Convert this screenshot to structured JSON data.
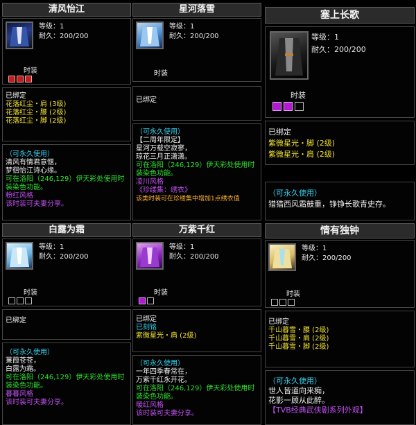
{
  "cards": {
    "c1": {
      "name": "清风怡江",
      "level": "等级：1",
      "durability": "耐久：200/200",
      "type": "时装",
      "bound": "已绑定",
      "sets": [
        "花落红尘・肩 (3级)",
        "花落红尘・腰 (2级)",
        "花落红尘・脚 (2级)"
      ],
      "usage": "（可永久使用）",
      "lines": [
        "清风有情君意惬，",
        "梦徊怡江诗心缘。",
        "可在洛阳（246,129）伊天彩处使用时",
        "装染色功能。",
        "粉红风格",
        "该时装可夫妻分享。"
      ]
    },
    "c2": {
      "name": "星河落雪",
      "level": "等级：1",
      "durability": "耐久：200/200",
      "type": "时装",
      "bound": "已绑定",
      "usage": "（可永久使用）",
      "lines": [
        "【二周年限定】",
        "星河万载空寂寥，",
        "琼花三月正潇潇。",
        "可在洛阳（246,129）伊天彩处使用时",
        "装染色功能。",
        "凌川风格",
        "《珍缕集：绣衣》",
        "该类时装可在珍缕集中增加1点绣衣值"
      ]
    },
    "c3": {
      "name": "塞上长歌",
      "level": "等级：1",
      "durability": "耐久：200/200",
      "type": "时装",
      "bound": "已绑定",
      "sets": [
        "紫微星光・脚 (2级)",
        "紫微星光・肩 (2级)"
      ],
      "usage": "（可永久使用）",
      "lines": [
        "猎猎西风霜鼓重，铮铮长歌青史存。"
      ]
    },
    "c4": {
      "name": "白露为霜",
      "level": "等级：1",
      "durability": "耐久：200/200",
      "type": "时装",
      "bound": "已绑定",
      "usage": "（可永久使用）",
      "lines": [
        "蒹葭苍苍，",
        "白露为霜。",
        "可在洛阳（246,129）伊天彩处使用时",
        "装染色功能。",
        "暮暮风格",
        "该时装可夫妻分享。"
      ]
    },
    "c5": {
      "name": "万紫千红",
      "level": "等级：1",
      "durability": "耐久：200/200",
      "type": "时装",
      "bound": "已绑定",
      "sets": [
        "已刻铭",
        "紫微星光・肩 (2级)"
      ],
      "usage": "（可永久使用）",
      "lines": [
        "一年四季春常在，",
        "万紫千红永开花。",
        "可在洛阳（246,129）伊天彩处使用时",
        "装染色功能。",
        "暖红风格",
        "该时装可夫妻分享。"
      ]
    },
    "c6": {
      "name": "情有独钟",
      "level": "等级：1",
      "durability": "耐久：200/200",
      "type": "时装",
      "bound": "已绑定",
      "sets": [
        "千山暮雪・腰 (2级)",
        "千山暮雪・肩 (2级)",
        "千山暮雪・脚 (2级)"
      ],
      "usage": "（可永久使用）",
      "lines": [
        "世人皆道向来痴，",
        "花影一顾从此醉。",
        "【TVB经典武侠剧系列外观】"
      ]
    }
  },
  "colors": {
    "gold": "#f0e030",
    "cyan": "#35d1f0",
    "green": "#2fe02f",
    "purple": "#c050f0",
    "orange": "#ffb030"
  },
  "icons": [
    "robe-portrait-icon",
    "gem-slot-icon"
  ]
}
